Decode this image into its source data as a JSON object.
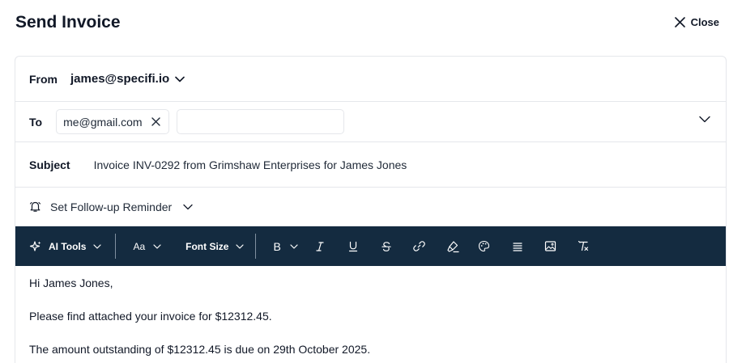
{
  "header": {
    "title": "Send Invoice",
    "close_label": "Close"
  },
  "from": {
    "label": "From",
    "value": "james@specifi.io"
  },
  "to": {
    "label": "To",
    "recipients": [
      "me@gmail.com"
    ],
    "input_value": ""
  },
  "subject": {
    "label": "Subject",
    "value": "Invoice INV-0292 from Grimshaw Enterprises for James Jones"
  },
  "reminder": {
    "label": "Set Follow-up Reminder"
  },
  "toolbar": {
    "ai_tools": "AI Tools",
    "font_family": "Aa",
    "font_size": "Font Size",
    "bold": "B",
    "icons": [
      "italic-icon",
      "underline-icon",
      "strikethrough-icon",
      "link-icon",
      "highlight-icon",
      "color-palette-icon",
      "align-icon",
      "image-icon",
      "clear-format-icon"
    ],
    "background": "#142b40"
  },
  "body": {
    "lines": [
      "Hi James Jones,",
      "Please find attached your invoice for $12312.45.",
      "The amount outstanding of $12312.45 is due on 29th October 2025."
    ]
  }
}
